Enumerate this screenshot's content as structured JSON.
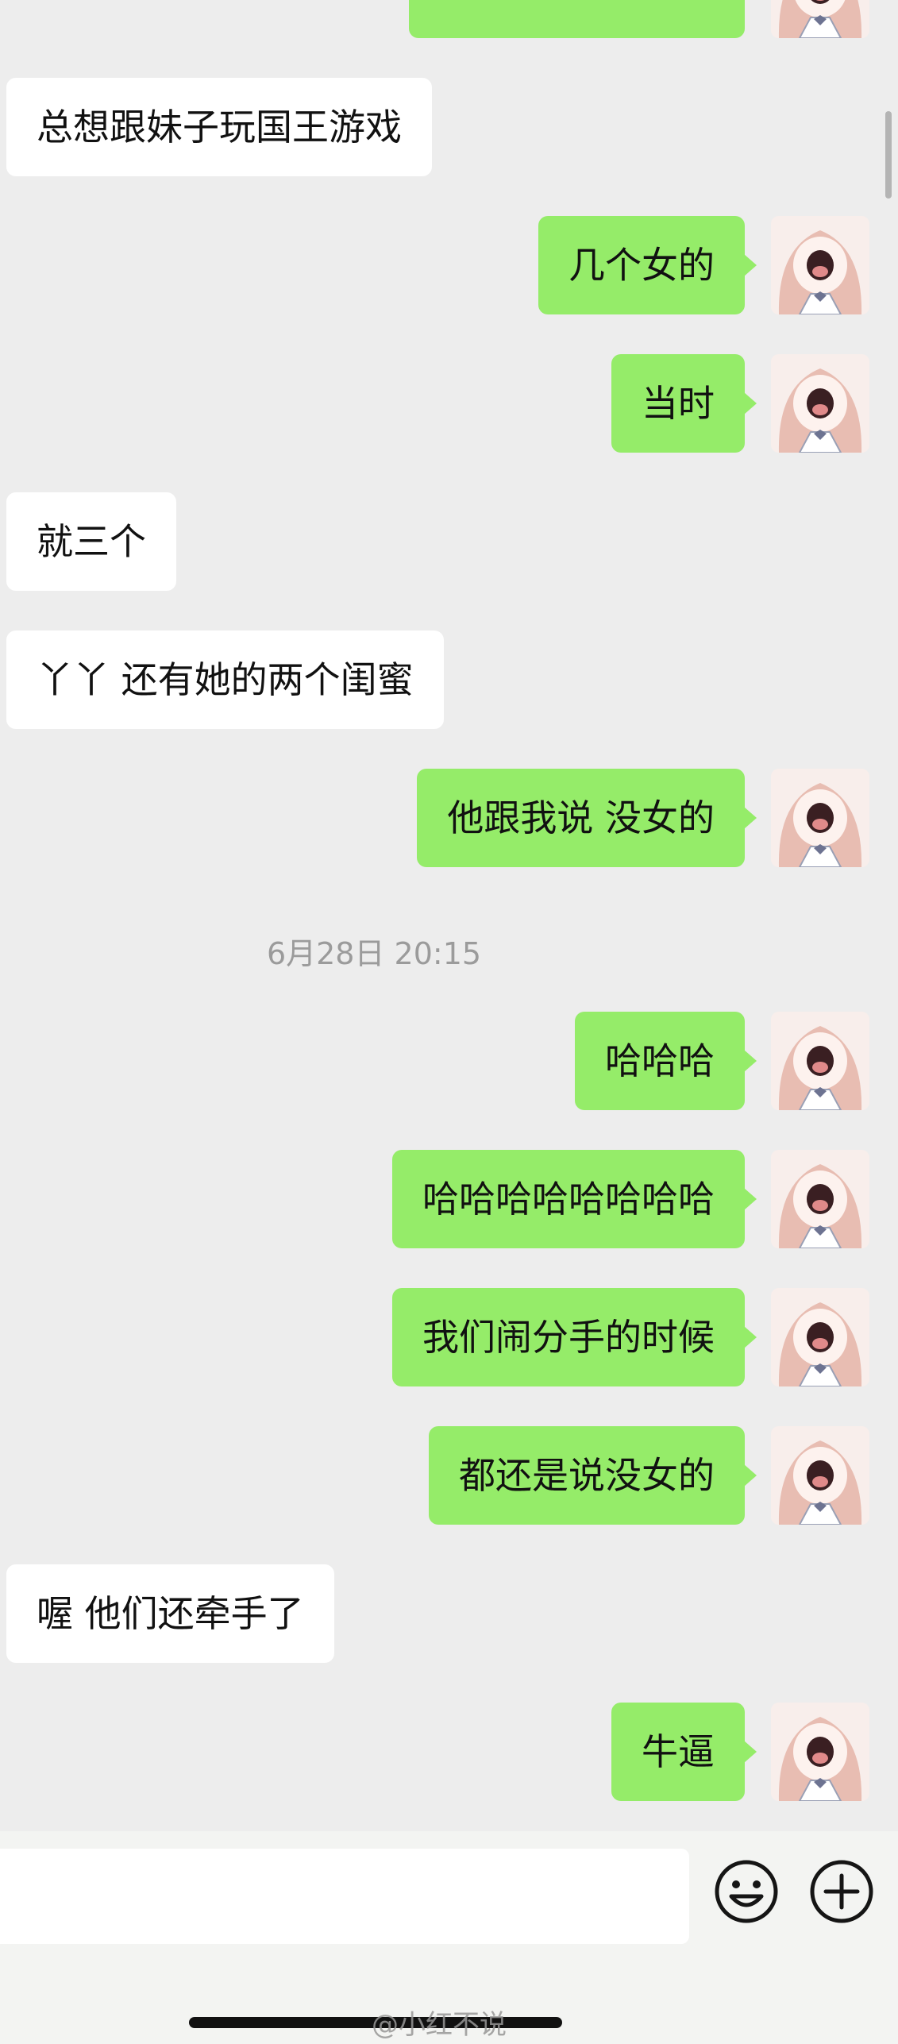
{
  "messages": [
    {
      "side": "out",
      "text": ""
    },
    {
      "side": "in",
      "text": "总想跟妹子玩国王游戏"
    },
    {
      "side": "out",
      "text": "几个女的"
    },
    {
      "side": "out",
      "text": "当时"
    },
    {
      "side": "in",
      "text": "就三个"
    },
    {
      "side": "in",
      "text": "丫丫 还有她的两个闺蜜"
    },
    {
      "side": "out",
      "text": "他跟我说 没女的"
    },
    {
      "side": "out",
      "text": "哈哈哈"
    },
    {
      "side": "out",
      "text": "哈哈哈哈哈哈哈哈"
    },
    {
      "side": "out",
      "text": "我们闹分手的时候"
    },
    {
      "side": "out",
      "text": "都还是说没女的"
    },
    {
      "side": "in",
      "text": "喔 他们还牵手了"
    },
    {
      "side": "out",
      "text": "牛逼"
    }
  ],
  "timestamp": "6月28日 20:15",
  "input": {
    "value": "",
    "emoji_icon": "smiley-face-icon",
    "more_icon": "plus-circle-icon"
  },
  "watermark": "@小红不说",
  "colors": {
    "background": "#ededed",
    "outgoing_bubble": "#95ec69",
    "incoming_bubble": "#ffffff"
  }
}
